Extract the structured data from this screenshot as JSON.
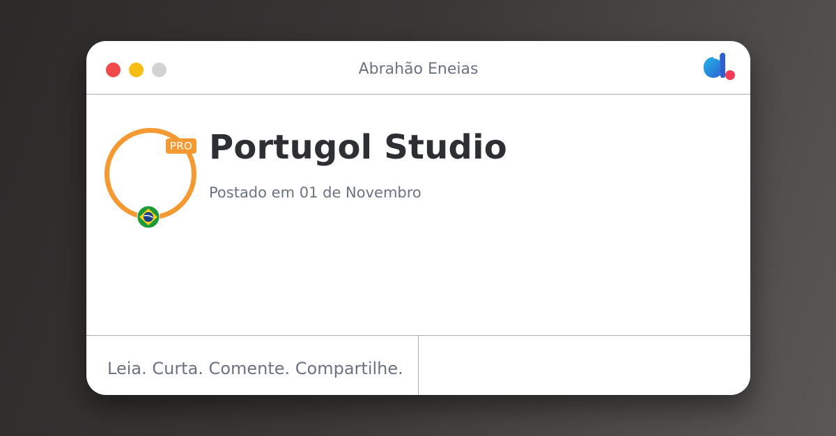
{
  "window": {
    "title": "Abrahão Eneias"
  },
  "post": {
    "title": "Portugol Studio",
    "date": "Postado em 01 de Novembro"
  },
  "author": {
    "badge": "PRO",
    "country_flag": "brazil-flag-icon"
  },
  "footer": {
    "tagline": "Leia. Curta. Comente. Compartilhe."
  },
  "icons": {
    "close": "close-icon",
    "minimize": "minimize-icon",
    "maximize": "maximize-icon",
    "brand": "brand-logo-icon"
  },
  "colors": {
    "accent": "#f59a33",
    "close": "#f04a4a",
    "minimize": "#f8bd12",
    "maximize": "#d2d2d2",
    "text_primary": "#2d2f33",
    "text_secondary": "#6b7280"
  }
}
